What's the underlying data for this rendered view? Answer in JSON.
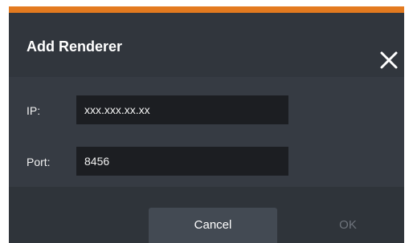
{
  "dialog": {
    "title": "Add Renderer",
    "close_icon": "close-icon",
    "accent_color": "#e37a1f"
  },
  "form": {
    "ip_label": "IP:",
    "ip_value": "xxx.xxx.xx.xx",
    "port_label": "Port:",
    "port_value": "8456"
  },
  "buttons": {
    "cancel_label": "Cancel",
    "ok_label": "OK"
  }
}
